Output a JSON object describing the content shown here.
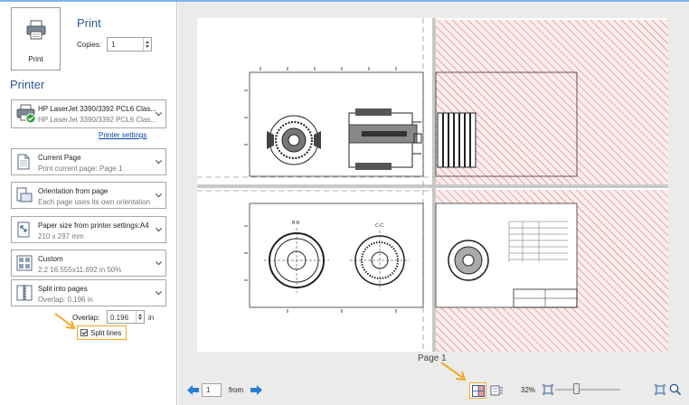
{
  "print": {
    "button_label": "Print",
    "title": "Print",
    "copies_label": "Copies:",
    "copies_value": "1"
  },
  "printer": {
    "heading": "Printer",
    "name": "HP LaserJet 3390/3392 PCL6 Clas...",
    "name_sub": "HP LaserJet 3390/3392 PCL6 Clas...",
    "settings_link": "Printer settings"
  },
  "options": [
    {
      "title": "Current Page",
      "subtitle": "Print current page: Page 1",
      "icon": "current-page-icon"
    },
    {
      "title": "Orientation from page",
      "subtitle": "Each page uses its own orientation",
      "icon": "orientation-icon"
    },
    {
      "title": "Paper size from printer settings:A4",
      "subtitle": "210 x 297 mm",
      "icon": "paper-size-icon"
    },
    {
      "title": "Custom",
      "subtitle": "2;2  16.555x11.692 in 50%",
      "icon": "pages-per-sheet-icon"
    },
    {
      "title": "Split into pages",
      "subtitle": "Overlap: 0.196 in",
      "icon": "split-pages-icon"
    }
  ],
  "overlap": {
    "label": "Overlap:",
    "value": "0.196",
    "unit": "in"
  },
  "split_lines": {
    "label": "Split lines",
    "checked": true
  },
  "preview": {
    "page_label": "Page 1",
    "page_number": "1",
    "from_label": "from",
    "zoom_label": "32%",
    "zoom_percent": 32
  },
  "colors": {
    "accent": "#2b5797",
    "highlight": "#f5a623",
    "hatch": "#d94c4c"
  }
}
